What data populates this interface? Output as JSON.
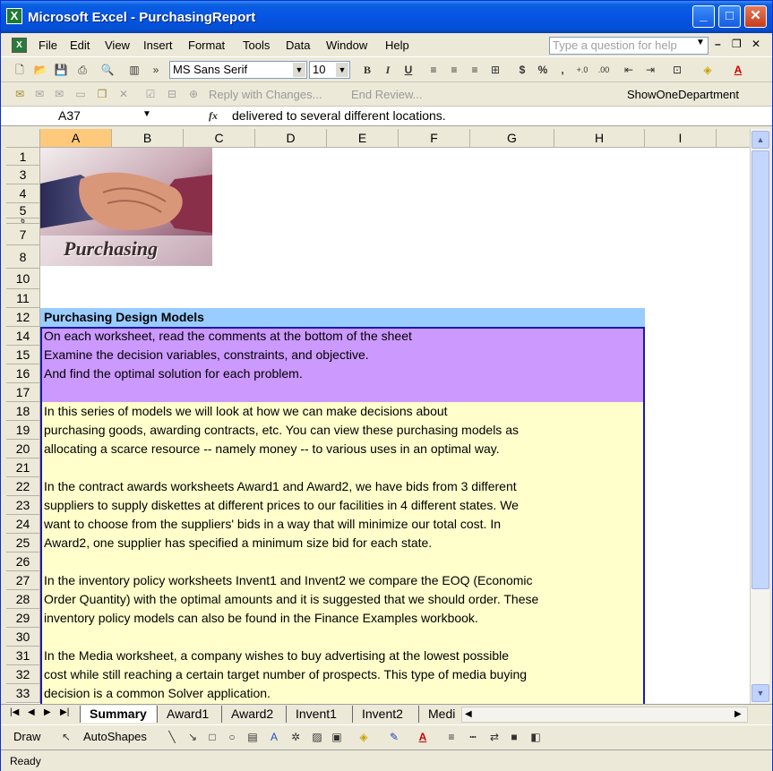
{
  "window": {
    "title": "Microsoft Excel - PurchasingReport",
    "app_icon": "X",
    "min": "_",
    "max": "□",
    "close": "✕"
  },
  "menu": {
    "items": [
      "File",
      "Edit",
      "View",
      "Insert",
      "Format",
      "Tools",
      "Data",
      "Window",
      "Help"
    ],
    "help_placeholder": "Type a question for help"
  },
  "format_toolbar": {
    "font_name": "MS Sans Serif",
    "font_size": "10"
  },
  "review_toolbar": {
    "reply": "Reply with Changes...",
    "end_review": "End Review...",
    "show_dept": "ShowOneDepartment"
  },
  "formula_bar": {
    "name_box": "A37",
    "fx": "fx",
    "formula": "delivered to several different locations."
  },
  "columns": [
    "A",
    "B",
    "C",
    "D",
    "E",
    "F",
    "G",
    "H",
    "I"
  ],
  "rows": [
    "1",
    "3",
    "4",
    "5",
    "6",
    "7",
    "8",
    "10",
    "11",
    "12",
    "14",
    "15",
    "16",
    "17",
    "18",
    "19",
    "20",
    "21",
    "22",
    "23",
    "24",
    "25",
    "26",
    "27",
    "28",
    "29",
    "30",
    "31",
    "32",
    "33"
  ],
  "picture": {
    "caption": "Purchasing"
  },
  "cells": {
    "header": "Purchasing Design Models",
    "purple": [
      "On each worksheet, read the comments at the bottom of the sheet",
      "Examine the decision variables, constraints, and objective.",
      "And find the optimal solution for each problem."
    ],
    "body": [
      "In this series of models we will look at how we can make decisions about",
      "purchasing goods, awarding contracts, etc.  You can view these purchasing models as",
      "allocating a scarce resource -- namely money -- to various uses in an optimal way.",
      "",
      "In the contract awards worksheets Award1 and Award2, we have bids from 3 different",
      "suppliers to supply diskettes at different prices to our facilities in 4 different states.  We",
      "want to choose from the suppliers' bids in a way that will minimize our total cost.  In",
      "Award2, one supplier has specified a minimum size bid for each state.",
      "",
      "In the inventory policy worksheets Invent1 and Invent2 we compare the EOQ (Economic",
      "Order Quantity) with the optimal amounts and it is suggested that we should order. These",
      "inventory policy models can also be found in the Finance Examples workbook.",
      "",
      "In the Media worksheet, a company wishes to buy advertising at the lowest possible",
      "cost while still reaching a certain target number of prospects.  This type of media buying",
      "decision is a common Solver application."
    ]
  },
  "sheet_tabs": [
    "Summary",
    "Award1",
    "Award2",
    "Invent1",
    "Invent2",
    "Medi"
  ],
  "drawing_toolbar": {
    "draw": "Draw",
    "autoshapes": "AutoShapes"
  },
  "status": {
    "text": "Ready"
  },
  "colors": {
    "header_band": "#99ccff",
    "purple_band": "#cc99ff",
    "yellow_band": "#ffffcc",
    "border": "#1a1aa8"
  }
}
